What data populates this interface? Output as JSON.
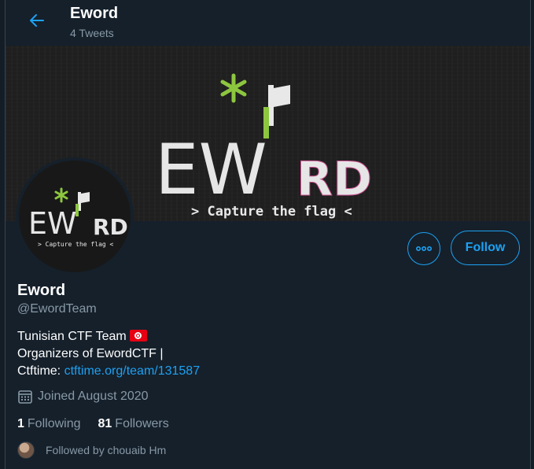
{
  "header": {
    "title": "Eword",
    "tweet_count": "4 Tweets"
  },
  "banner": {
    "logo_text": "EW",
    "logo_text2": "RD",
    "tagline": "> Capture the flag <"
  },
  "avatar": {
    "logo_text": "EW",
    "logo_text2": "RD",
    "tagline": "> Capture the flag <"
  },
  "profile": {
    "name": "Eword",
    "handle": "@EwordTeam",
    "bio_line1": "Tunisian CTF Team",
    "bio_line2": "Organizers of EwordCTF |",
    "bio_line3_prefix": "Ctftime: ",
    "bio_link": "ctftime.org/team/131587",
    "joined": "Joined August 2020",
    "following_count": "1",
    "following_label": "Following",
    "followers_count": "81",
    "followers_label": "Followers",
    "followed_by": "Followed by chouaib Hm"
  },
  "actions": {
    "follow_label": "Follow",
    "more_glyph": "∘∘∘"
  },
  "colors": {
    "accent": "#1da1f2",
    "background": "#15202b",
    "secondary_text": "#8899a6",
    "logo_green": "#8dc63f",
    "flag_red": "#e70013"
  }
}
